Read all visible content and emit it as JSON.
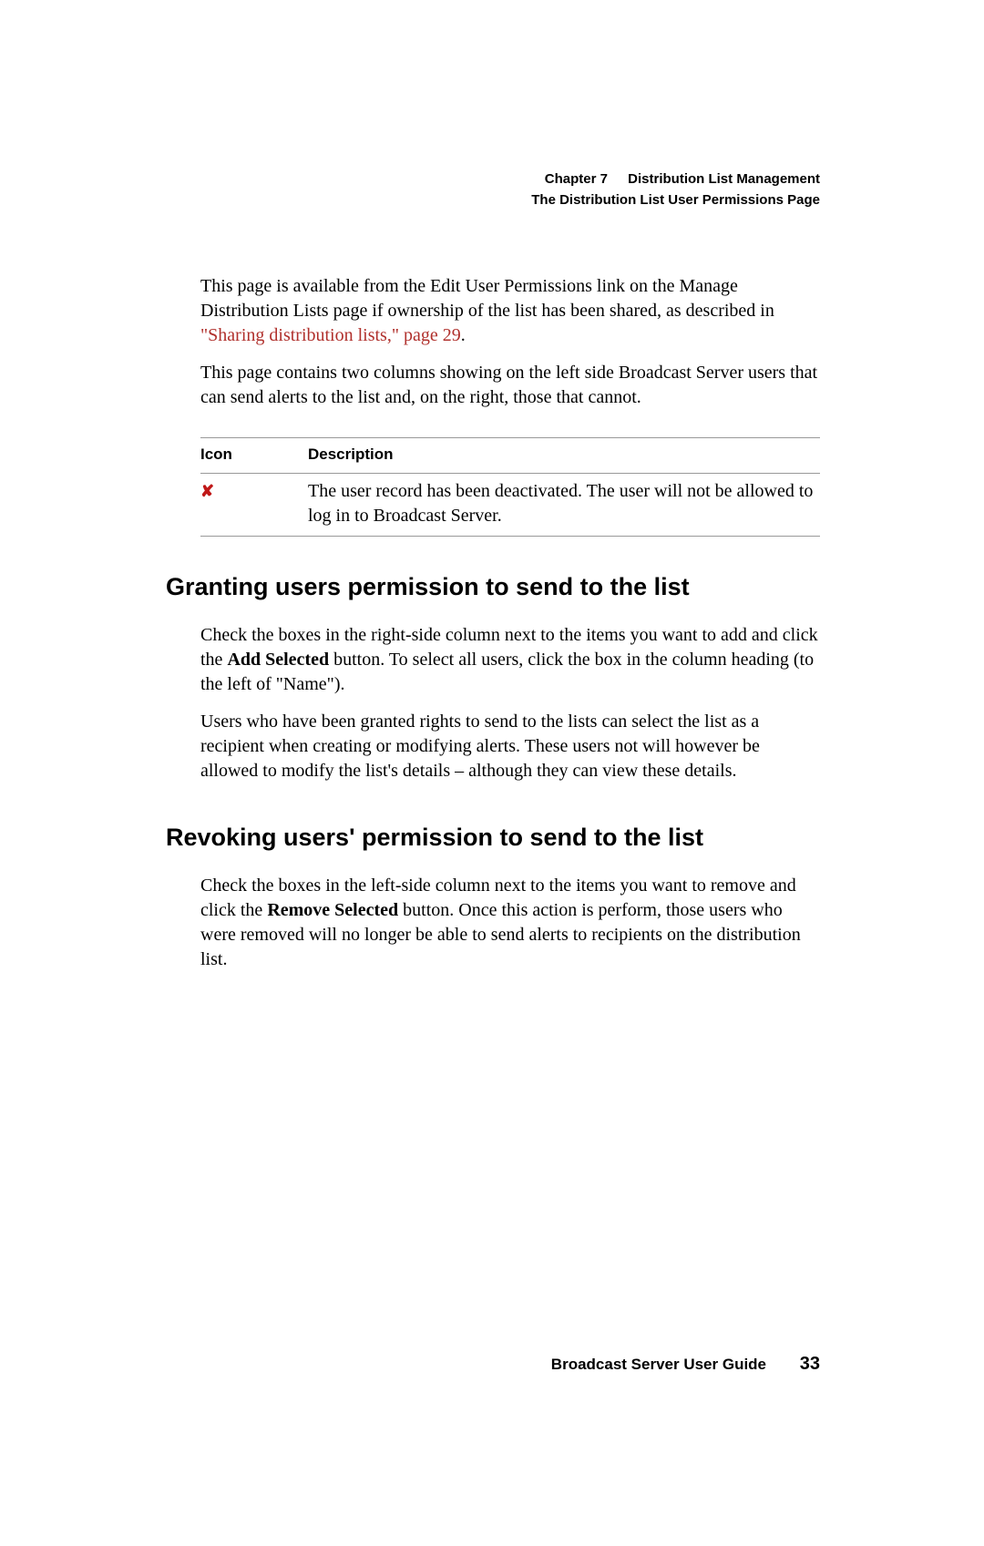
{
  "header": {
    "chapter": "Chapter 7",
    "title": "Distribution List Management",
    "subtitle": "The Distribution List User Permissions Page"
  },
  "intro": {
    "p1_a": "This page is available from the Edit User Permissions link on the Manage Distribution Lists page if ownership of the list has been shared, as described in ",
    "p1_link": "\"Sharing distribution lists,\" page 29",
    "p1_b": ".",
    "p2": "This page contains two columns showing on the left side Broadcast Server users that can send alerts to the list and, on the right, those that cannot."
  },
  "table": {
    "head_icon": "Icon",
    "head_desc": "Description",
    "row1_desc": "The user record has been deactivated. The user will not be allowed to log in to Broadcast Server."
  },
  "section1": {
    "heading": "Granting users permission to send to the list",
    "p1_a": "Check the boxes in the right-side column next to the items you want to add and click the ",
    "p1_bold": "Add Selected",
    "p1_b": " button. To select all users, click the box in the column heading (to the left of \"Name\").",
    "p2": "Users who have been granted rights to send to the lists can select the list as a recipient when creating or modifying alerts. These users not will however be allowed to modify the list's details – although they can view these details."
  },
  "section2": {
    "heading": "Revoking users' permission to send to the list",
    "p1_a": "Check the boxes in the left-side column next to the items you want to remove and click the ",
    "p1_bold": "Remove Selected",
    "p1_b": " button. Once this action is perform, those users who were removed will no longer be able to send alerts to recipients on the distribution list."
  },
  "footer": {
    "guide": "Broadcast Server User Guide",
    "page": "33"
  }
}
